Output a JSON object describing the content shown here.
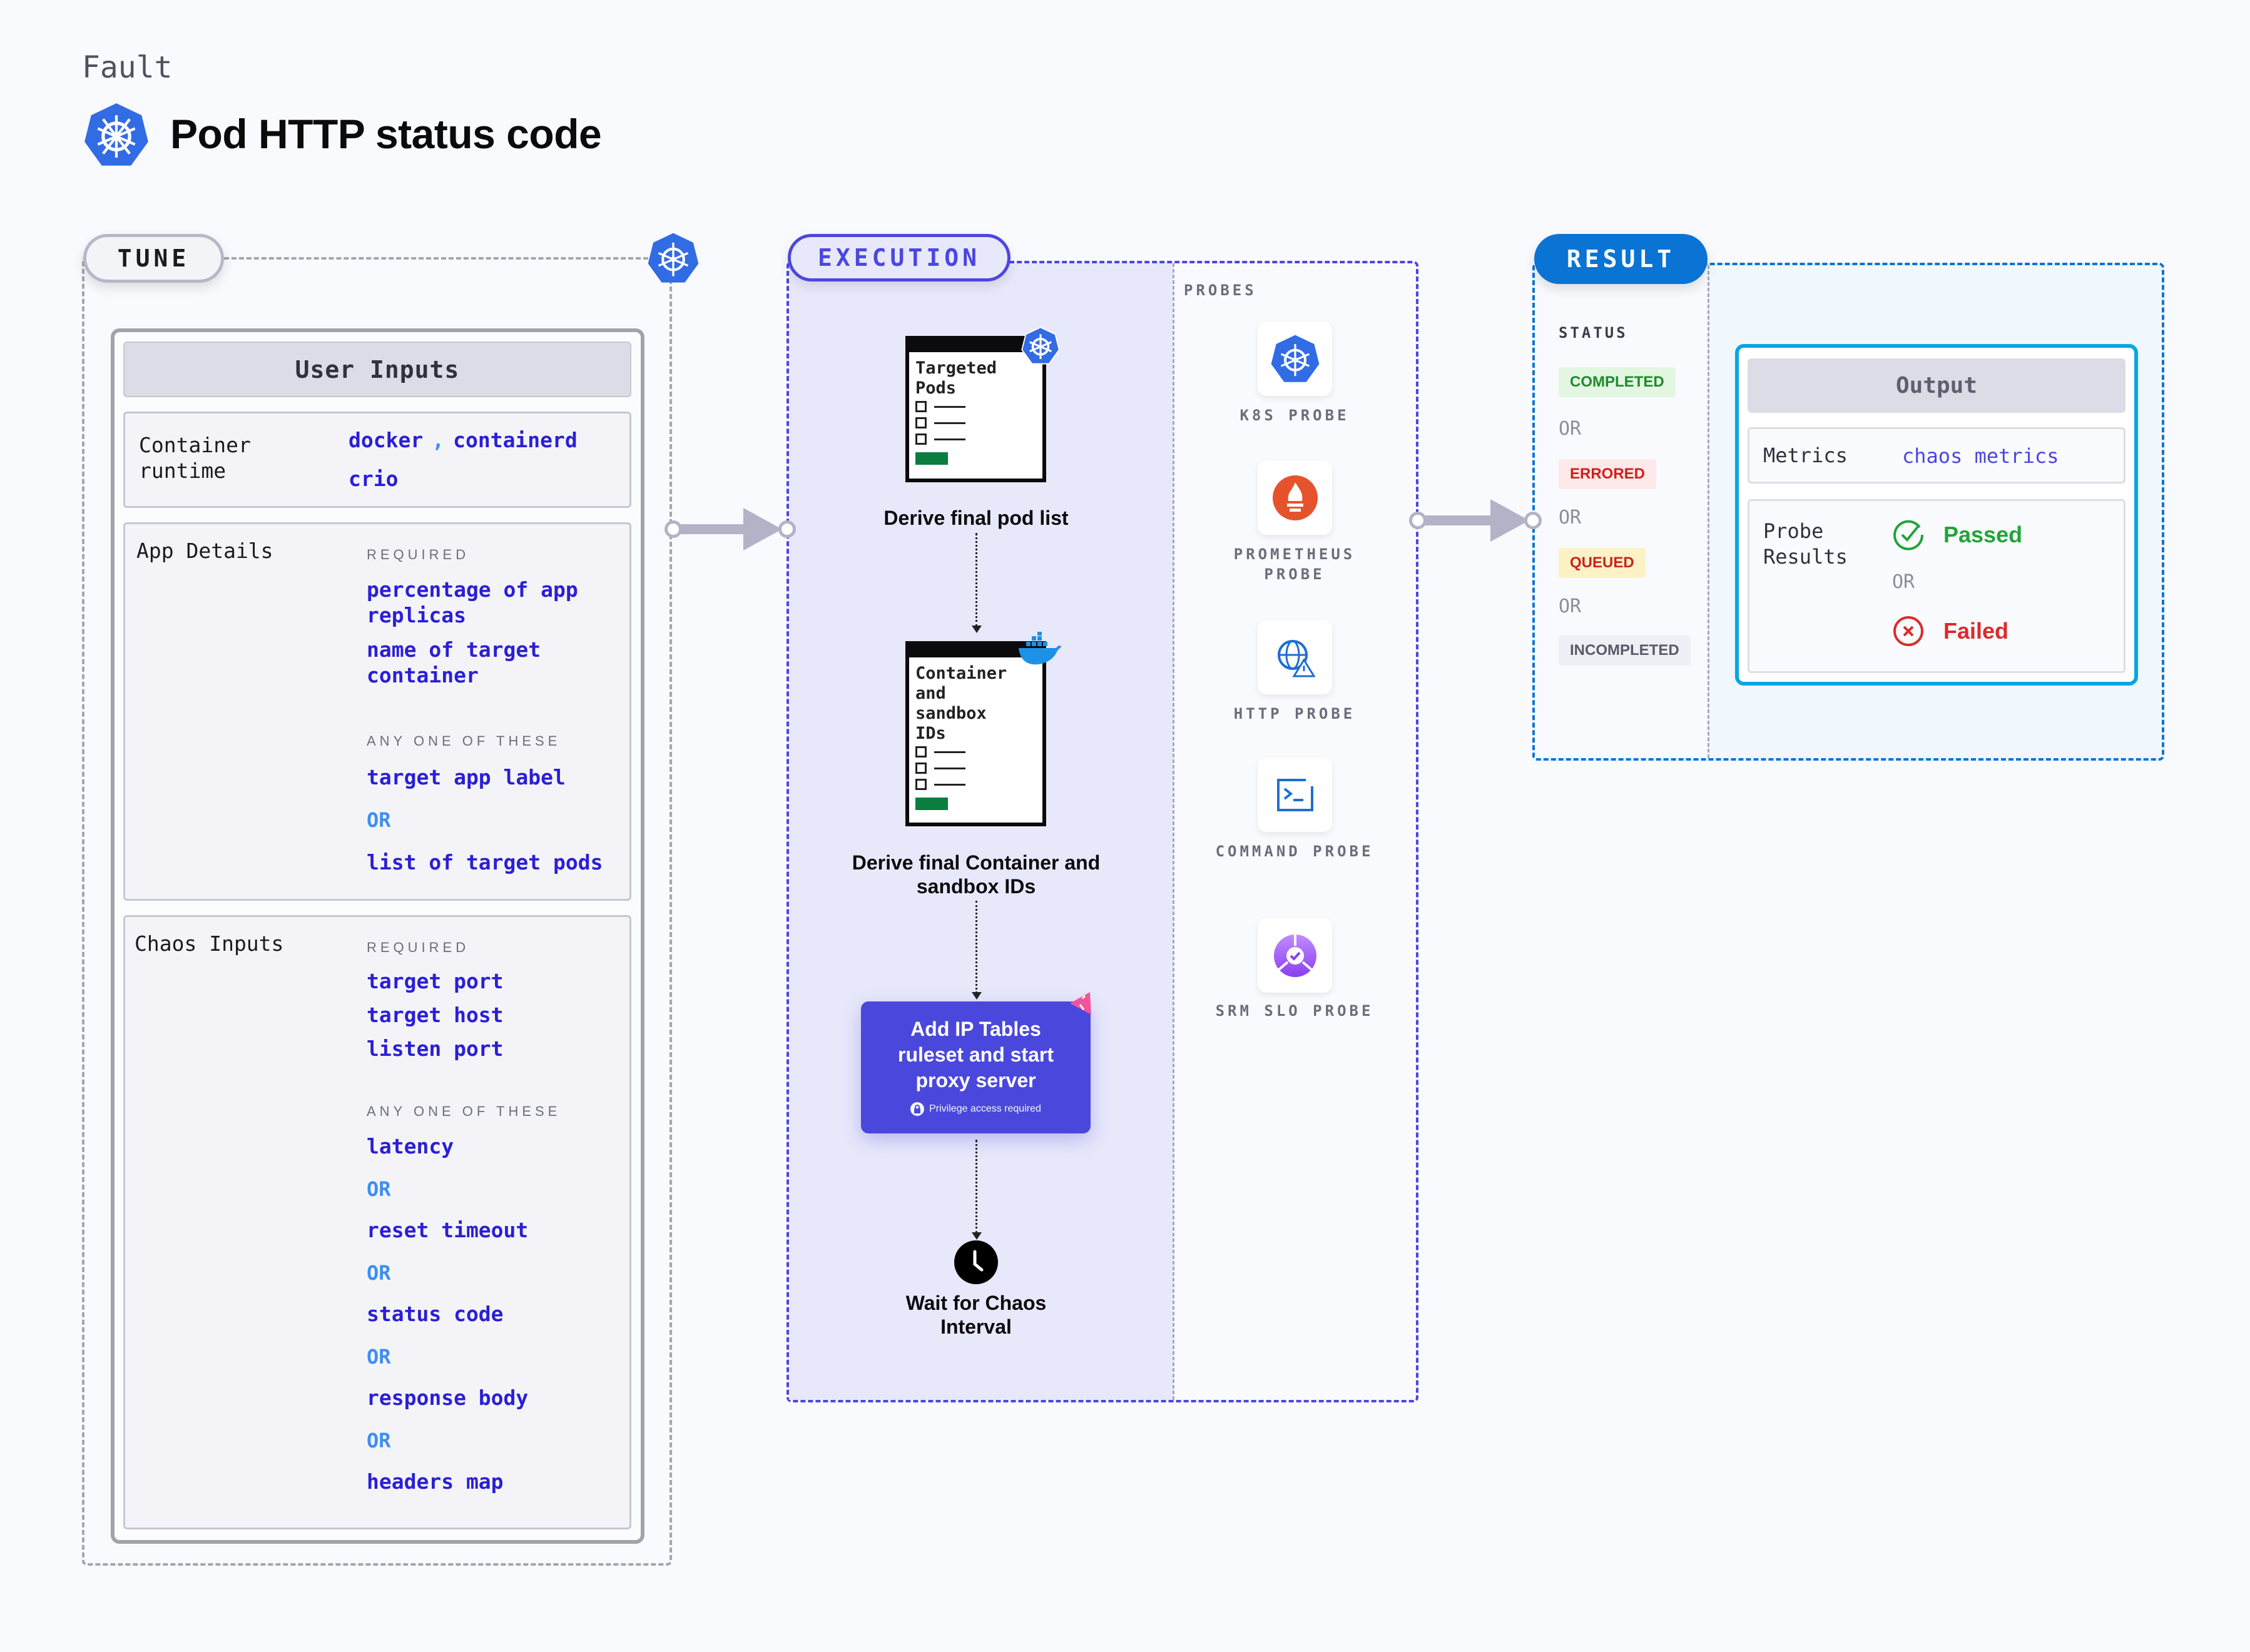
{
  "header": {
    "category": "Fault",
    "title": "Pod HTTP status code",
    "icon": "kubernetes-icon"
  },
  "colors": {
    "tune_border": "#a3a6ae",
    "execution_accent": "#4b47e0",
    "result_accent": "#0a74d4",
    "value_text": "#2a1fd6",
    "or_text": "#3d8fef",
    "kubernetes_blue": "#326ce5"
  },
  "tune": {
    "label": "TUNE",
    "user_inputs_title": "User Inputs",
    "container_runtime": {
      "label": "Container runtime",
      "values": [
        "docker",
        "containerd",
        "crio"
      ],
      "separator": ","
    },
    "app_details": {
      "label": "App Details",
      "required_label": "REQUIRED",
      "required": [
        "percentage of app replicas",
        "name of target container"
      ],
      "any_one_label": "ANY ONE OF THESE",
      "any_one": [
        "target app label",
        "list of target pods"
      ],
      "or_label": "OR"
    },
    "chaos_inputs": {
      "label": "Chaos Inputs",
      "required_label": "REQUIRED",
      "required": [
        "target port",
        "target host",
        "listen port"
      ],
      "any_one_label": "ANY ONE OF THESE",
      "any_one": [
        "latency",
        "reset timeout",
        "status code",
        "response body",
        "headers map"
      ],
      "or_label": "OR"
    }
  },
  "execution": {
    "label": "EXECUTION",
    "steps": [
      {
        "card_title": "Targeted Pods",
        "badge_icon": "kubernetes-icon",
        "label": "Derive final pod list"
      },
      {
        "card_title": "Container and sandbox IDs",
        "badge_icon": "docker-icon",
        "label": "Derive final Container and sandbox IDs"
      },
      {
        "label": "Add IP Tables ruleset and start proxy server",
        "note": "Privilege access required",
        "badge_icon": "chaos-icon"
      },
      {
        "label": "Wait for Chaos Interval",
        "icon": "clock-icon"
      }
    ],
    "probes_label": "PROBES",
    "probes": [
      {
        "label": "K8S PROBE",
        "icon": "kubernetes-icon"
      },
      {
        "label": "PROMETHEUS PROBE",
        "icon": "prometheus-icon"
      },
      {
        "label": "HTTP PROBE",
        "icon": "http-globe-icon"
      },
      {
        "label": "COMMAND PROBE",
        "icon": "terminal-icon"
      },
      {
        "label": "SRM SLO PROBE",
        "icon": "srm-slo-icon"
      }
    ]
  },
  "result": {
    "label": "RESULT",
    "status_label": "STATUS",
    "or_label": "OR",
    "statuses": [
      {
        "label": "COMPLETED",
        "color": "#1e8a2e",
        "bg": "#e3f6e1"
      },
      {
        "label": "ERRORED",
        "color": "#d11f1f",
        "bg": "#fde9e9"
      },
      {
        "label": "QUEUED",
        "color": "#c5251c",
        "bg": "#fdf2c6"
      },
      {
        "label": "INCOMPLETED",
        "color": "#585a6a",
        "bg": "#eff0f5"
      }
    ],
    "output": {
      "title": "Output",
      "metrics_label": "Metrics",
      "metrics_value": "chaos metrics",
      "probe_results_label": "Probe Results",
      "passed": "Passed",
      "failed": "Failed",
      "or_label": "OR"
    }
  }
}
